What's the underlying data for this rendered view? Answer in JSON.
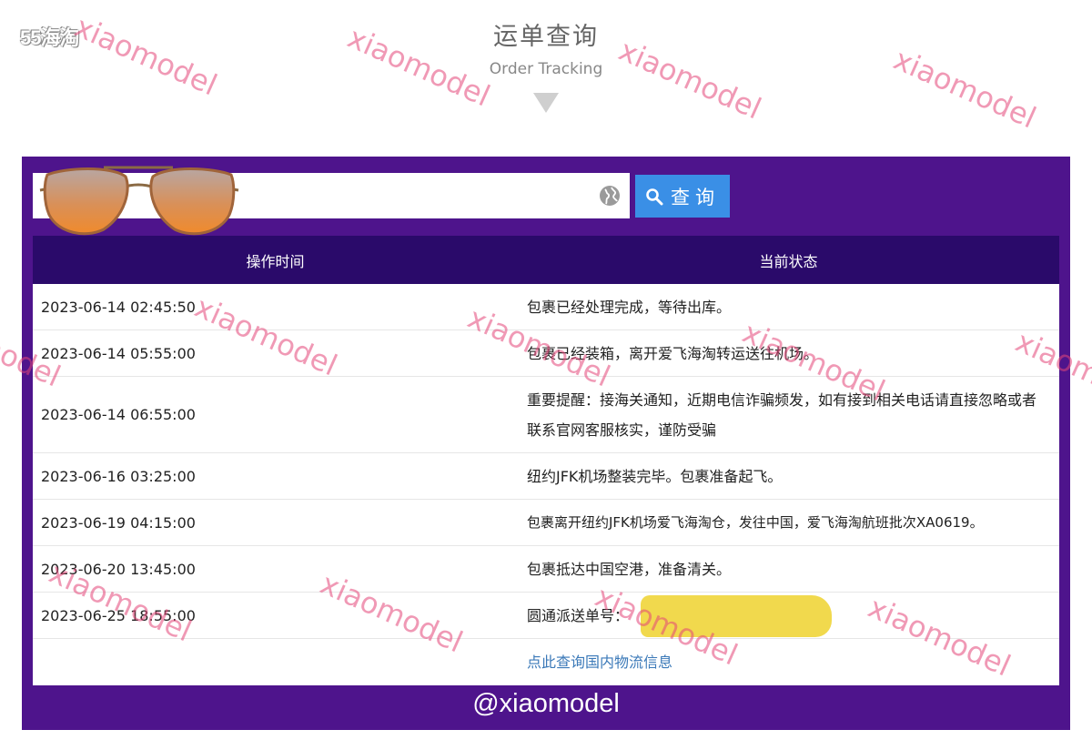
{
  "site": {
    "logo_text": "55海淘"
  },
  "header": {
    "title_cn": "运单查询",
    "title_en": "Order Tracking"
  },
  "search": {
    "placeholder": "",
    "button_label": "查询"
  },
  "table": {
    "columns": [
      "操作时间",
      "当前状态"
    ],
    "rows": [
      {
        "time": "2023-06-14 02:45:50",
        "status": "包裹已经处理完成，等待出库。"
      },
      {
        "time": "2023-06-14 05:55:00",
        "status": "包裹已经装箱，离开爱飞海淘转运送往机场。"
      },
      {
        "time": "2023-06-14 06:55:00",
        "status": "重要提醒：接海关通知，近期电信诈骗频发，如有接到相关电话请直接忽略或者联系官网客服核实，谨防受骗"
      },
      {
        "time": "2023-06-16 03:25:00",
        "status": "纽约JFK机场整装完毕。包裹准备起飞。"
      },
      {
        "time": "2023-06-19 04:15:00",
        "status": "包裹离开纽约JFK机场爱飞海淘仓，发往中国，爱飞海淘航班批次XA0619。"
      },
      {
        "time": "2023-06-20 13:45:00",
        "status": "包裹抵达中国空港，准备清关。"
      },
      {
        "time": "2023-06-25 18:55:00",
        "status": "圆通派送单号："
      }
    ],
    "link_text": "点此查询国内物流信息"
  },
  "overlay": {
    "handle": "@xiaomodel",
    "watermark": "xiaomodel"
  },
  "colors": {
    "panel": "#4e148c",
    "table_header": "#2a0a6a",
    "button": "#3a8fe6",
    "link": "#3b79b8",
    "watermark": "#e44678",
    "redaction": "#f1d94d"
  }
}
